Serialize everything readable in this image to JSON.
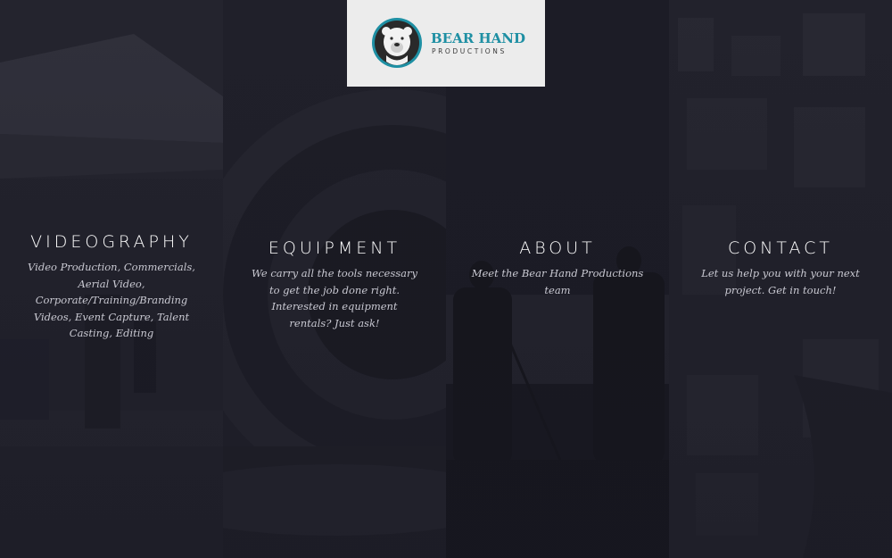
{
  "logo": {
    "name": "BEAR HAND",
    "subtitle": "PRODUCTIONS",
    "icon": "bear-icon",
    "colors": {
      "accent": "#1e8fa3",
      "box": "#ececec"
    }
  },
  "panels": [
    {
      "title": "VIDEOGRAPHY",
      "description": "Video Production, Commercials, Aerial Video, Corporate/Training/Branding Videos, Event Capture, Talent Casting, Editing"
    },
    {
      "title": "EQUIPMENT",
      "description": "We carry all the tools necessary to get the job done right. Interested in equipment rentals? Just ask!"
    },
    {
      "title": "ABOUT",
      "description": "Meet the Bear Hand Productions team"
    },
    {
      "title": "CONTACT",
      "description": "Let us help you with your next project. Get in touch!"
    }
  ],
  "colors": {
    "background": "#1c1c26",
    "title": "#ffffff",
    "description": "#c9c9d2"
  }
}
